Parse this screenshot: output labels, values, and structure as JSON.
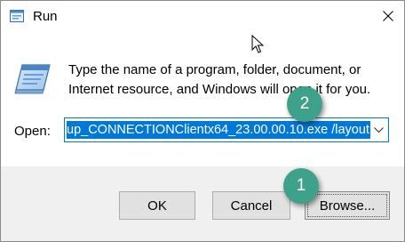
{
  "window": {
    "title": "Run",
    "close_icon": "close-icon",
    "app_icon": "run-app-icon"
  },
  "description": {
    "line1": "Type the name of a program, folder, document, or",
    "line2": "Internet resource, and Windows will open it for you."
  },
  "open_field": {
    "label": "Open:",
    "value": "up_CONNECTIONClientx64_23.00.00.10.exe /layout"
  },
  "buttons": {
    "ok": "OK",
    "cancel": "Cancel",
    "browse": "Browse..."
  },
  "annotations": {
    "badge_1": "1",
    "badge_2": "2",
    "color": "#3ea28a"
  },
  "colors": {
    "accent": "#0078d7",
    "footer_bg": "#f0f0f0"
  }
}
